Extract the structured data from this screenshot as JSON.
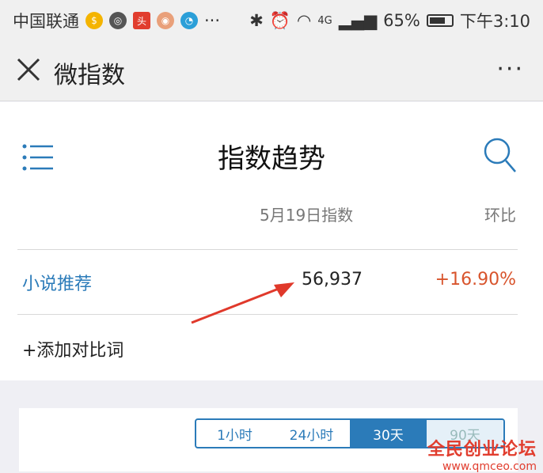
{
  "status_bar": {
    "carrier": "中国联通",
    "battery": "65%",
    "time": "下午3:10",
    "network": "4G",
    "more": "···"
  },
  "titlebar": {
    "title": "微指数",
    "more": "···"
  },
  "page": {
    "title": "指数趋势",
    "col_date": "5月19日指数",
    "col_ratio": "环比"
  },
  "row": {
    "keyword": "小说推荐",
    "value": "56,937",
    "change": "+16.90%"
  },
  "add_label": "+添加对比词",
  "range_tabs": [
    "1小时",
    "24小时",
    "30天",
    "90天"
  ],
  "watermark": {
    "title": "全民创业论坛",
    "url": "www.qmceo.com"
  },
  "colors": {
    "accent": "#2b7bb9",
    "change": "#d8542c",
    "arrow": "#e0392b",
    "watermark": "#e13d2e"
  }
}
